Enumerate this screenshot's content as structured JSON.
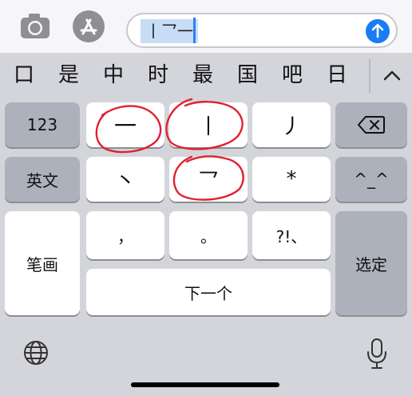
{
  "message": {
    "composed_text": "丨乛一",
    "send_icon": "arrow-up-icon"
  },
  "toolbar": {
    "camera_icon": "camera-icon",
    "appstore_icon": "app-store-icon"
  },
  "candidates": [
    "口",
    "是",
    "中",
    "时",
    "最",
    "国",
    "吧",
    "日"
  ],
  "keyboard": {
    "left_keys": [
      "123",
      "英文",
      "笔画"
    ],
    "stroke_keys": [
      "一",
      "丨",
      "丿",
      "丶",
      "乛",
      "*"
    ],
    "punct_keys": [
      "，",
      "。",
      "?!、"
    ],
    "next_label": "下一个",
    "confirm_label": "选定",
    "emoji_label": "^_^",
    "delete_icon": "backspace-icon",
    "globe_icon": "globe-icon",
    "mic_icon": "microphone-icon",
    "expand_icon": "chevron-up-icon"
  },
  "annotations": {
    "color": "#e0202e",
    "circled_keys": [
      "一",
      "丨",
      "乛"
    ]
  }
}
